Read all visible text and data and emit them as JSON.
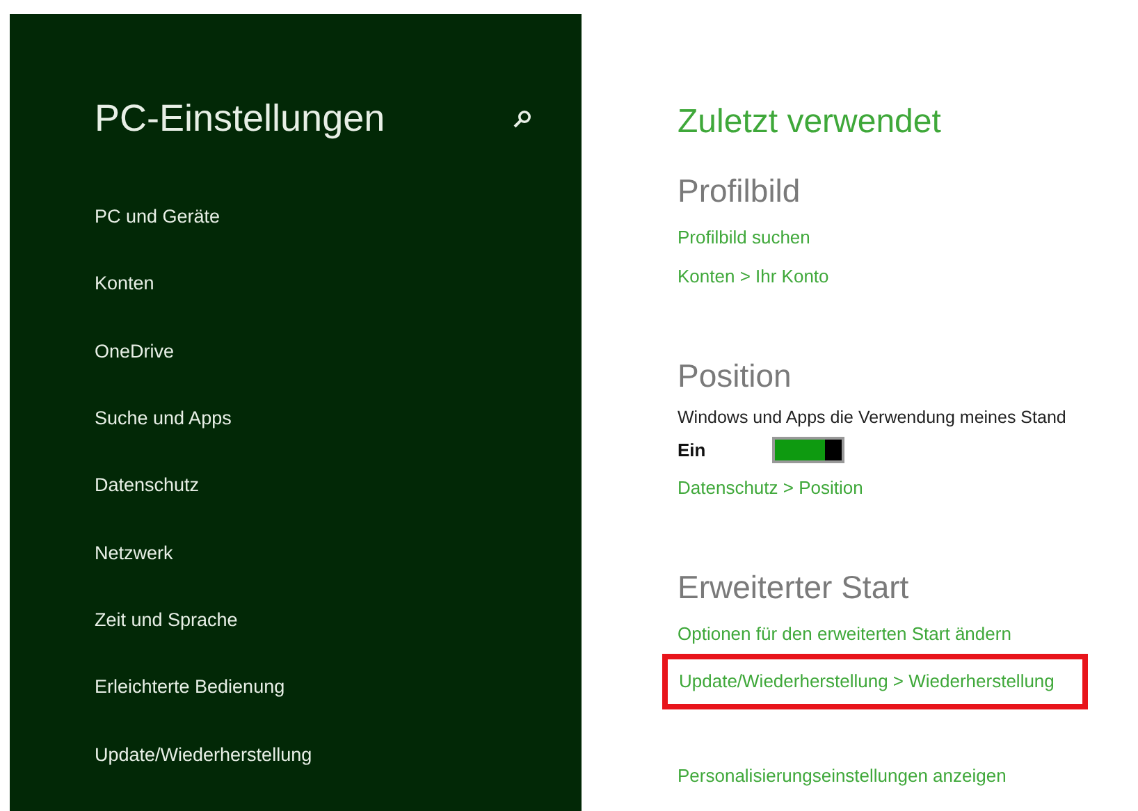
{
  "sidebar": {
    "title": "PC-Einstellungen",
    "items": [
      {
        "label": "PC und Geräte"
      },
      {
        "label": "Konten"
      },
      {
        "label": "OneDrive"
      },
      {
        "label": "Suche und Apps"
      },
      {
        "label": "Datenschutz"
      },
      {
        "label": "Netzwerk"
      },
      {
        "label": "Zeit und Sprache"
      },
      {
        "label": "Erleichterte Bedienung"
      },
      {
        "label": "Update/Wiederherstellung"
      }
    ]
  },
  "content": {
    "title": "Zuletzt verwendet",
    "sections": [
      {
        "heading": "Profilbild",
        "entries": [
          {
            "kind": "link",
            "text": "Profilbild suchen",
            "highlighted": false
          },
          {
            "kind": "link",
            "text": "Konten > Ihr Konto",
            "highlighted": false
          }
        ]
      },
      {
        "heading": "Position",
        "entries": [
          {
            "kind": "text",
            "text": "Windows und Apps die Verwendung meines Stand"
          },
          {
            "kind": "toggle",
            "label": "Ein",
            "on": true
          },
          {
            "kind": "link",
            "text": "Datenschutz > Position",
            "highlighted": false
          }
        ]
      },
      {
        "heading": "Erweiterter Start",
        "entries": [
          {
            "kind": "link",
            "text": "Optionen für den erweiterten Start ändern",
            "highlighted": false
          },
          {
            "kind": "link",
            "text": "Update/Wiederherstellung > Wiederherstellung",
            "highlighted": true
          }
        ]
      }
    ],
    "footer_link": "Personalisierungseinstellungen anzeigen"
  }
}
